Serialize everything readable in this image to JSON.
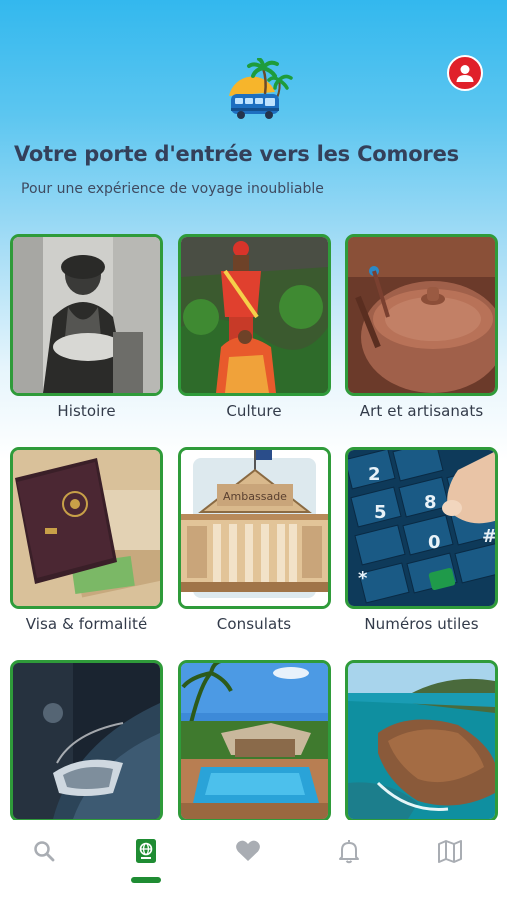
{
  "header": {
    "title": "Votre porte d'entrée vers les Comores",
    "subtitle": "Pour une expérience de voyage inoubliable"
  },
  "tiles": [
    {
      "label": "Histoire",
      "image": "vintage-portrait-photo"
    },
    {
      "label": "Culture",
      "image": "traditional-dress-photo"
    },
    {
      "label": "Art et artisanats",
      "image": "clay-pottery-photo"
    },
    {
      "label": "Visa & formalité",
      "image": "passport-photo"
    },
    {
      "label": "Consulats",
      "image": "embassy-building-illustration",
      "sign": "Ambassade"
    },
    {
      "label": "Numéros utiles",
      "image": "phone-keypad-photo"
    },
    {
      "label": "",
      "image": "car-headlight-photo"
    },
    {
      "label": "",
      "image": "resort-pool-photo"
    },
    {
      "label": "",
      "image": "coastline-photo"
    }
  ],
  "nav": {
    "items": [
      {
        "name": "search",
        "icon": "search-icon"
      },
      {
        "name": "guide",
        "icon": "passport-globe-icon",
        "active": true
      },
      {
        "name": "favorites",
        "icon": "heart-icon"
      },
      {
        "name": "notifications",
        "icon": "bell-icon"
      },
      {
        "name": "map",
        "icon": "map-icon"
      }
    ]
  },
  "colors": {
    "accent": "#2f9b3a",
    "active_nav": "#1f8c33",
    "inactive_nav": "#a9adb3",
    "profile": "#e0202a",
    "title_text": "#34405a"
  }
}
